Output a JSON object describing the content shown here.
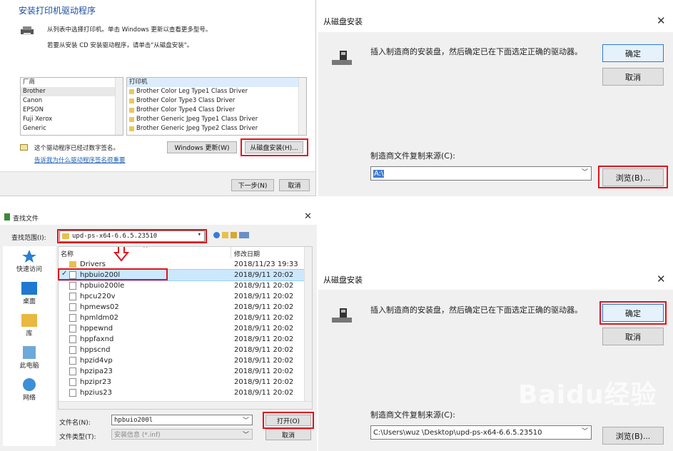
{
  "d1": {
    "title": "安装打印机驱动程序",
    "desc1": "从列表中选择打印机。单击 Windows 更新以查看更多型号。",
    "desc2": "若要从安装 CD 安装驱动程序，请单击\"从磁盘安装\"。",
    "mfr_header": "厂商",
    "manufacturers": [
      "Brother",
      "Canon",
      "EPSON",
      "Fuji Xerox",
      "Generic"
    ],
    "printer_header": "打印机",
    "printers": [
      "Brother Color Leg Type1 Class Driver",
      "Brother Color Type3 Class Driver",
      "Brother Color Type4 Class Driver",
      "Brother Generic Jpeg Type1 Class Driver",
      "Brother Generic Jpeg Type2 Class Driver"
    ],
    "signed_text": "这个驱动程序已经过数字签名。",
    "link": "告诉我为什么驱动程序签名很重要",
    "windows_update": "Windows 更新(W)",
    "have_disk": "从磁盘安装(H)...",
    "next": "下一步(N)",
    "cancel": "取消"
  },
  "d2": {
    "title": "从磁盘安装",
    "instr": "插入制造商的安装盘，然后确定已在下面选定正确的驱动器。",
    "ok": "确定",
    "cancel": "取消",
    "copy_label": "制造商文件复制来源(C):",
    "path": "A:\\",
    "browse": "浏览(B)..."
  },
  "d3": {
    "title": "查找文件",
    "lookin_label": "查找范围(I):",
    "lookin_value": "upd-ps-x64-6.6.5.23510",
    "nav": [
      "快速访问",
      "桌面",
      "库",
      "此电脑",
      "网络"
    ],
    "col_name": "名称",
    "col_date": "修改日期",
    "files": [
      {
        "name": "Drivers",
        "date": "2018/11/23 19:33"
      },
      {
        "name": "hpbuio200l",
        "date": "2018/9/11 20:02"
      },
      {
        "name": "hpbuio200le",
        "date": "2018/9/11 20:02"
      },
      {
        "name": "hpcu220v",
        "date": "2018/9/11 20:02"
      },
      {
        "name": "hpmews02",
        "date": "2018/9/11 20:02"
      },
      {
        "name": "hpmldm02",
        "date": "2018/9/11 20:02"
      },
      {
        "name": "hppewnd",
        "date": "2018/9/11 20:02"
      },
      {
        "name": "hppfaxnd",
        "date": "2018/9/11 20:02"
      },
      {
        "name": "hppscnd",
        "date": "2018/9/11 20:02"
      },
      {
        "name": "hpzid4vp",
        "date": "2018/9/11 20:02"
      },
      {
        "name": "hpzipa23",
        "date": "2018/9/11 20:02"
      },
      {
        "name": "hpzipr23",
        "date": "2018/9/11 20:02"
      },
      {
        "name": "hpzius23",
        "date": "2018/9/11 20:02"
      }
    ],
    "filename_label": "文件名(N):",
    "filename_value": "hpbuio200l",
    "filetype_label": "文件类型(T):",
    "filetype_value": "安装信息 (*.inf)",
    "open": "打开(O)",
    "cancel": "取消"
  },
  "d4": {
    "title": "从磁盘安装",
    "instr": "插入制造商的安装盘，然后确定已在下面选定正确的驱动器。",
    "ok": "确定",
    "cancel": "取消",
    "copy_label": "制造商文件复制来源(C):",
    "path": "C:\\Users\\wuz   \\Desktop\\upd-ps-x64-6.6.5.23510",
    "browse": "浏览(B)..."
  },
  "watermark": "Baidu经验",
  "colors": {
    "red": "#e0141e",
    "blue": "#2b7bd6",
    "link": "#1a5fb4",
    "selected": "#cce8ff"
  }
}
